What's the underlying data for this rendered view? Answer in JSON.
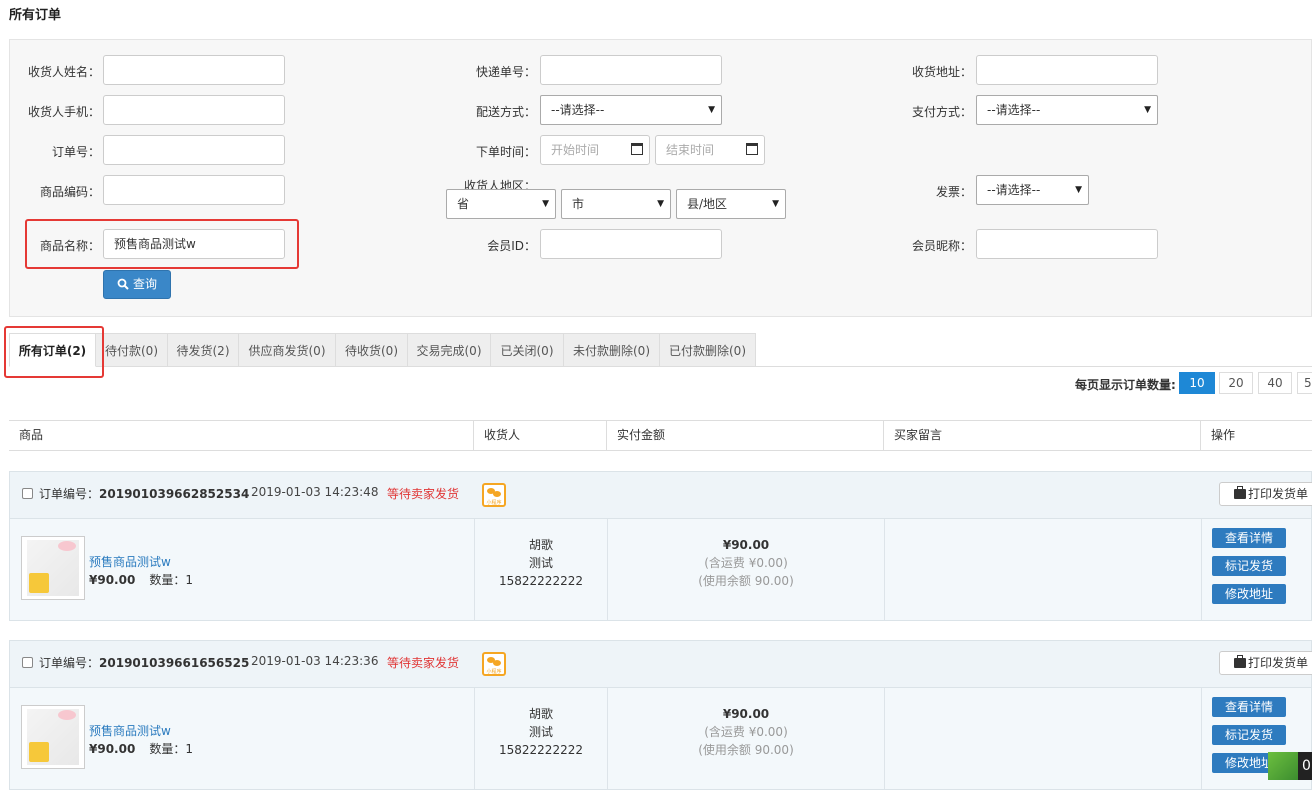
{
  "page_title": "所有订单",
  "filters": {
    "receiver_name_label": "收货人姓名：",
    "receiver_phone_label": "收货人手机：",
    "order_no_label": "订单号：",
    "goods_code_label": "商品编码：",
    "goods_name_label": "商品名称：",
    "goods_name_value": "预售商品测试w",
    "express_no_label": "快递单号：",
    "delivery_label": "配送方式：",
    "delivery_value": "--请选择--",
    "order_time_label": "下单时间：",
    "start_time_placeholder": "开始时间",
    "end_time_placeholder": "结束时间",
    "region_label": "收货人地区：",
    "province": "省",
    "city": "市",
    "county": "县/地区",
    "member_id_label": "会员ID：",
    "address_label": "收货地址：",
    "pay_label": "支付方式：",
    "pay_value": "--请选择--",
    "invoice_label": "发票：",
    "invoice_value": "--请选择--",
    "member_nick_label": "会员昵称：",
    "query_button": "查询"
  },
  "tabs": [
    "所有订单(2)",
    "待付款(0)",
    "待发货(2)",
    "供应商发货(0)",
    "待收货(0)",
    "交易完成(0)",
    "已关闭(0)",
    "未付款删除(0)",
    "已付款删除(0)"
  ],
  "per_page": {
    "label": "每页显示订单数量:",
    "options": [
      "10",
      "20",
      "40",
      "5"
    ],
    "selected": "10"
  },
  "columns": [
    "商品",
    "收货人",
    "实付金额",
    "买家留言",
    "操作"
  ],
  "orders": [
    {
      "no_label": "订单编号：",
      "no": "201901039662852534",
      "time": "2019-01-03 14:23:48",
      "status": "等待卖家发货",
      "mini_badge": "小程序",
      "print_label": "打印发货单",
      "product": "预售商品测试w",
      "price": "¥90.00",
      "qty_text": "数量：1",
      "receiver": [
        "胡歌",
        "测试",
        "15822222222"
      ],
      "amount": "¥90.00",
      "shipping": "(含运费 ¥0.00)",
      "balance": "(使用余额 90.00)",
      "actions": [
        "查看详情",
        "标记发货",
        "修改地址"
      ]
    },
    {
      "no_label": "订单编号：",
      "no": "201901039661656525",
      "time": "2019-01-03 14:23:36",
      "status": "等待卖家发货",
      "mini_badge": "小程序",
      "print_label": "打印发货单",
      "product": "预售商品测试w",
      "price": "¥90.00",
      "qty_text": "数量：1",
      "receiver": [
        "胡歌",
        "测试",
        "15822222222"
      ],
      "amount": "¥90.00",
      "shipping": "(含运费 ¥0.00)",
      "balance": "(使用余额 90.00)",
      "actions": [
        "查看详情",
        "标记发货",
        "修改地址"
      ]
    }
  ],
  "corner_badge": "0",
  "colors": {
    "accent": "#2e7bbf",
    "status": "#e03535",
    "highlight": "#e53935",
    "mini": "#f5a623"
  }
}
